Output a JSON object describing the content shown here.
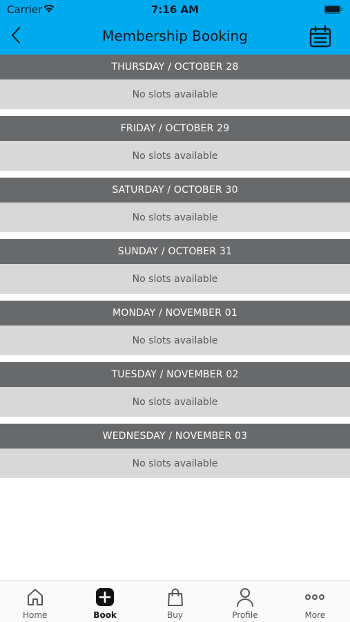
{
  "status_bar": {
    "carrier": "Carrier",
    "time": "7:16 AM"
  },
  "nav": {
    "title": "Membership Booking",
    "back_icon": "chevron-left-icon",
    "calendar_icon": "calendar-icon"
  },
  "days": [
    {
      "label": "THURSDAY / OCTOBER 28",
      "status": "No slots available"
    },
    {
      "label": "FRIDAY / OCTOBER 29",
      "status": "No slots available"
    },
    {
      "label": "SATURDAY / OCTOBER 30",
      "status": "No slots available"
    },
    {
      "label": "SUNDAY / OCTOBER 31",
      "status": "No slots available"
    },
    {
      "label": "MONDAY / NOVEMBER 01",
      "status": "No slots available"
    },
    {
      "label": "TUESDAY / NOVEMBER 02",
      "status": "No slots available"
    },
    {
      "label": "WEDNESDAY / NOVEMBER 03",
      "status": "No slots available"
    }
  ],
  "tabbar": {
    "items": [
      {
        "label": "Home",
        "icon": "home-icon",
        "active": false
      },
      {
        "label": "Book",
        "icon": "plus-square-icon",
        "active": true
      },
      {
        "label": "Buy",
        "icon": "shopping-bag-icon",
        "active": false
      },
      {
        "label": "Profile",
        "icon": "person-icon",
        "active": false
      },
      {
        "label": "More",
        "icon": "more-dots-icon",
        "active": false
      }
    ]
  },
  "colors": {
    "header_bg": "#00aaee",
    "day_header_bg": "#68696b",
    "slot_bg": "#d8d8d8"
  }
}
